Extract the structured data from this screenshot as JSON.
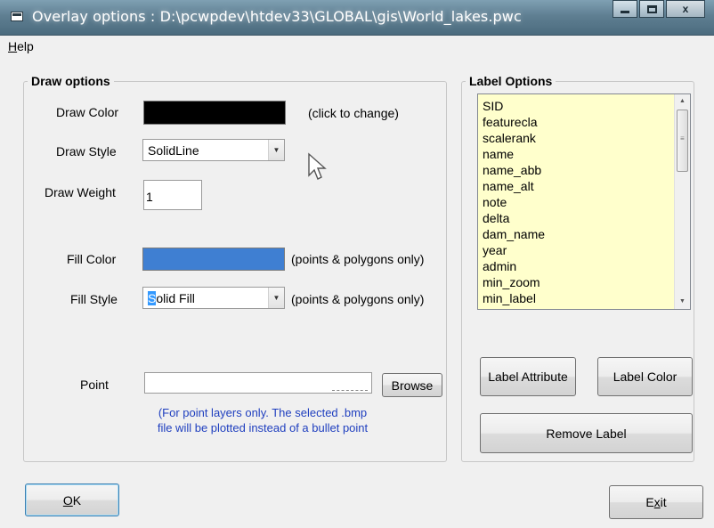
{
  "window": {
    "title": "Overlay options : D:\\pcwpdev\\htdev33\\GLOBAL\\gis\\World_lakes.pwc",
    "app_icon": "window-app-icon",
    "controls": {
      "minimize": "minimize-icon",
      "maximize": "maximize-icon",
      "close": "x"
    }
  },
  "menu": {
    "help_first": "H",
    "help_rest": "elp"
  },
  "draw_options": {
    "legend": "Draw options",
    "draw_color_label": "Draw Color",
    "draw_color": "#000000",
    "draw_color_hint": "(click to change)",
    "draw_style_label": "Draw Style",
    "draw_style_value": "SolidLine",
    "draw_weight_label": "Draw Weight",
    "draw_weight_value": "1",
    "fill_color_label": "Fill Color",
    "fill_color": "#3f7fd2",
    "fill_color_hint": "(points & polygons only)",
    "fill_style_label": "Fill Style",
    "fill_style_first": "S",
    "fill_style_rest": "olid Fill",
    "fill_style_hint": "(points & polygons only)",
    "point_label": "Point",
    "browse_label": "Browse",
    "point_note_line1": "(For point layers only.  The selected .bmp",
    "point_note_line2": "file will be plotted instead of a bullet point"
  },
  "label_options": {
    "legend": "Label Options",
    "fields": [
      "SID",
      "featurecla",
      "scalerank",
      "name",
      "name_abb",
      "name_alt",
      "note",
      "delta",
      "dam_name",
      "year",
      "admin",
      "min_zoom",
      "min_label"
    ],
    "label_attribute_button": "Label Attribute",
    "label_color_button": "Label Color",
    "remove_label_button": "Remove Label"
  },
  "footer": {
    "ok_first": "O",
    "ok_rest": "K",
    "exit_first": "E",
    "exit_underline": "x",
    "exit_rest": "it"
  },
  "colors": {
    "listbox_bg": "#ffffcc",
    "hint_blue": "#1f3fbf",
    "titlebar": "#5f7f92"
  }
}
